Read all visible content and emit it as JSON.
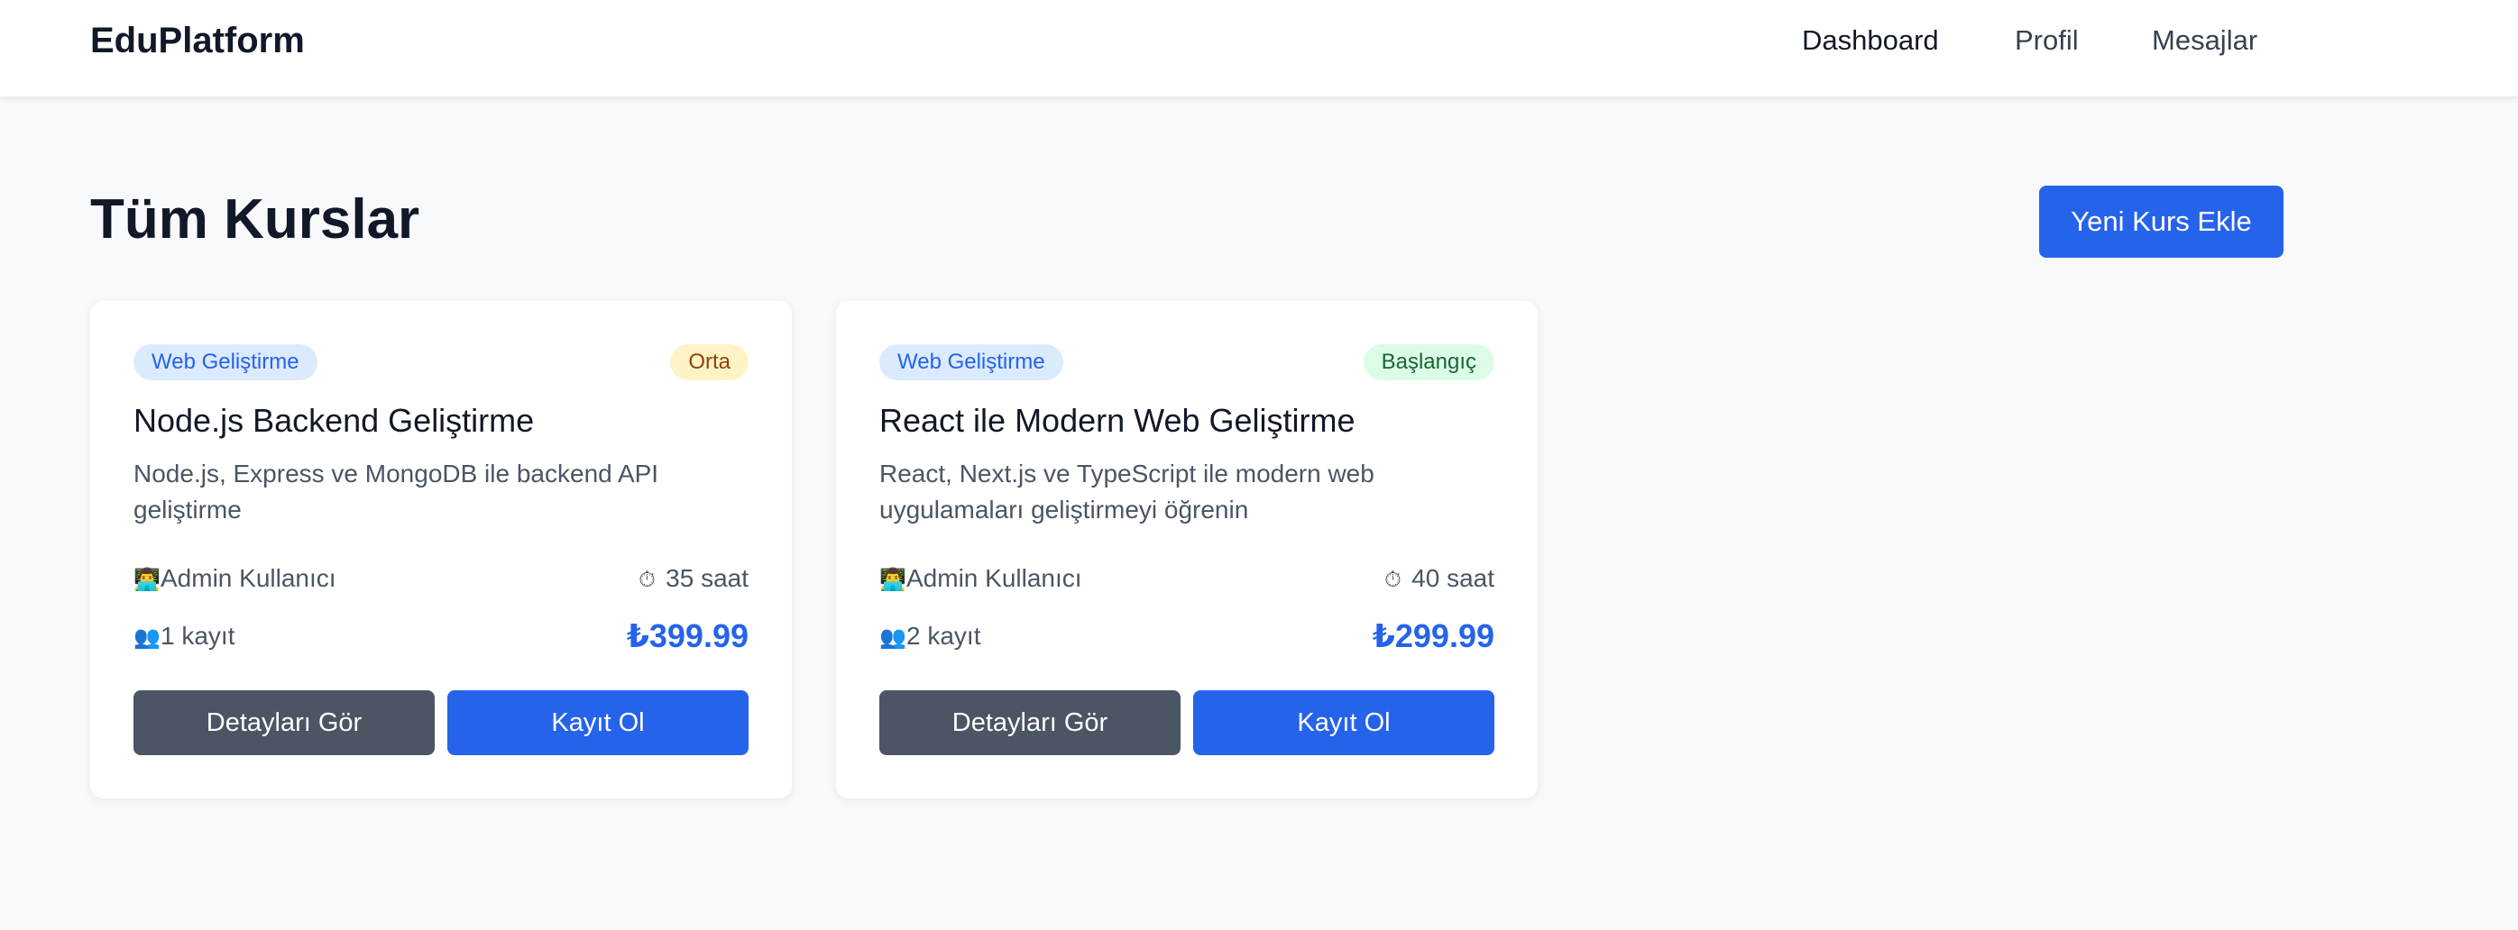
{
  "nav": {
    "brand": "EduPlatform",
    "links": [
      "Dashboard",
      "Profil",
      "Mesajlar"
    ]
  },
  "page": {
    "title": "Tüm Kurslar",
    "new_course_button": "Yeni Kurs Ekle"
  },
  "courses": [
    {
      "category": "Web Geliştirme",
      "level": "Orta",
      "title": "Node.js Backend Geliştirme",
      "description": "Node.js, Express ve MongoDB ile backend API geliştirme",
      "instructor": "Admin Kullanıcı",
      "duration": "35 saat",
      "enrollments": "1 kayıt",
      "price": "₺399.99",
      "details_button": "Detayları Gör",
      "enroll_button": "Kayıt Ol"
    },
    {
      "category": "Web Geliştirme",
      "level": "Başlangıç",
      "title": "React ile Modern Web Geliştirme",
      "description": "React, Next.js ve TypeScript ile modern web uygulamaları geliştirmeyi öğrenin",
      "instructor": "Admin Kullanıcı",
      "duration": "40 saat",
      "enrollments": "2 kayıt",
      "price": "₺299.99",
      "details_button": "Detayları Gör",
      "enroll_button": "Kayıt Ol"
    }
  ],
  "icons": {
    "instructor": "👨‍💻",
    "duration": "⏱",
    "enrollments": "👥"
  },
  "colors": {
    "primary": "#2563eb",
    "secondary_button": "#4b5563",
    "category_badge_bg": "#dbeafe",
    "level_orta_bg": "#fef3c7",
    "level_baslangic_bg": "#dcfce7"
  }
}
